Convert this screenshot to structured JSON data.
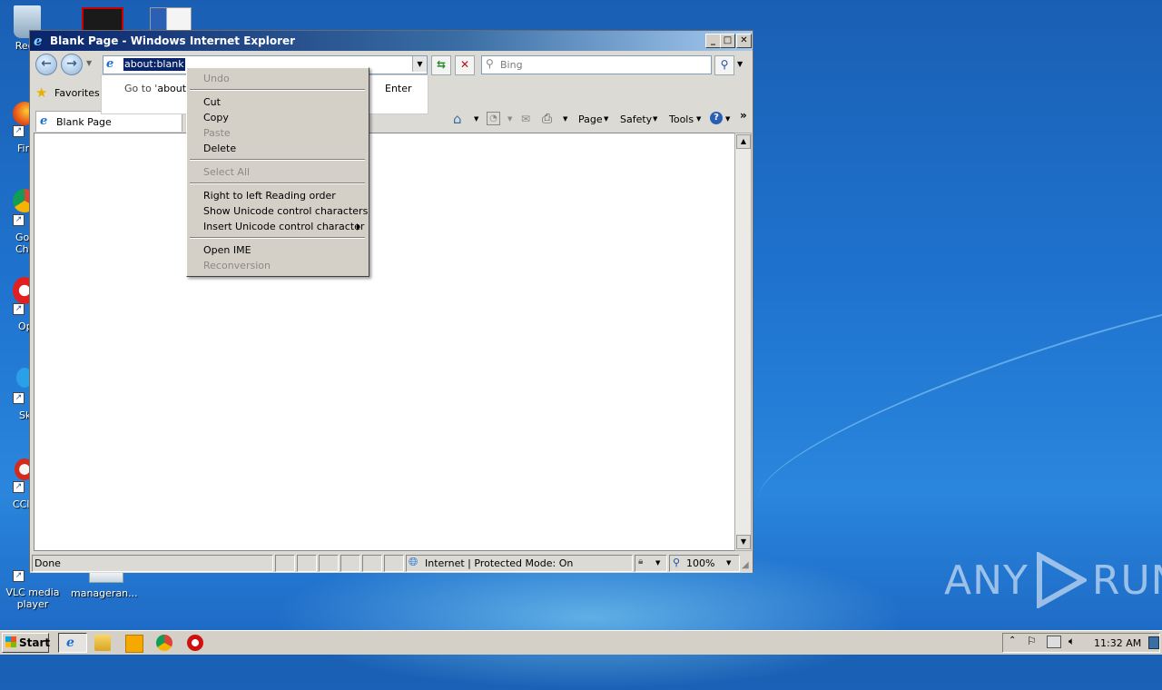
{
  "desktop": {
    "icons": [
      {
        "label": "Recy"
      },
      {
        "label": "Fir"
      },
      {
        "label": "Go Chr"
      },
      {
        "label": "Op"
      },
      {
        "label": "Sk"
      },
      {
        "label": "CCl"
      },
      {
        "label": "VLC media player"
      },
      {
        "label": "manageran..."
      }
    ],
    "watermark": {
      "text_left": "ANY",
      "text_right": "RUN"
    }
  },
  "window": {
    "title": "Blank Page - Windows Internet Explorer",
    "caption_buttons": {
      "minimize": "_",
      "maximize": "□",
      "close": "✕"
    },
    "address": {
      "value": "about:blank"
    },
    "search": {
      "placeholder": "Bing"
    },
    "favorites_label": "Favorites",
    "autocomplete": {
      "goto_prefix": "Go to '",
      "goto_value": "about:b",
      "enter_label": "Enter"
    },
    "tab": {
      "label": "Blank Page"
    },
    "command_bar": {
      "page": "Page",
      "safety": "Safety",
      "tools": "Tools"
    },
    "status": {
      "text": "Done",
      "zone": "Internet | Protected Mode: On",
      "zoom": "100%"
    }
  },
  "context_menu": {
    "items": [
      {
        "label": "Undo",
        "enabled": false
      },
      {
        "label": "Cut",
        "enabled": true
      },
      {
        "label": "Copy",
        "enabled": true
      },
      {
        "label": "Paste",
        "enabled": false
      },
      {
        "label": "Delete",
        "enabled": true
      },
      {
        "label": "Select All",
        "enabled": false
      },
      {
        "label": "Right to left Reading order",
        "enabled": true
      },
      {
        "label": "Show Unicode control characters",
        "enabled": true
      },
      {
        "label": "Insert Unicode control character",
        "enabled": true
      },
      {
        "label": "Open IME",
        "enabled": true
      },
      {
        "label": "Reconversion",
        "enabled": false
      }
    ]
  },
  "taskbar": {
    "start_label": "Start",
    "clock": "11:32 AM"
  }
}
